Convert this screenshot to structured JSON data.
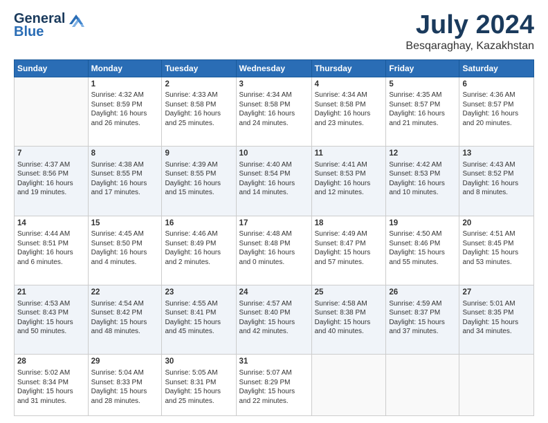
{
  "logo": {
    "line1": "General",
    "line2": "Blue"
  },
  "title": "July 2024",
  "subtitle": "Besqaraghay, Kazakhstan",
  "days_header": [
    "Sunday",
    "Monday",
    "Tuesday",
    "Wednesday",
    "Thursday",
    "Friday",
    "Saturday"
  ],
  "weeks": [
    [
      {
        "day": "",
        "info": ""
      },
      {
        "day": "1",
        "info": "Sunrise: 4:32 AM\nSunset: 8:59 PM\nDaylight: 16 hours\nand 26 minutes."
      },
      {
        "day": "2",
        "info": "Sunrise: 4:33 AM\nSunset: 8:58 PM\nDaylight: 16 hours\nand 25 minutes."
      },
      {
        "day": "3",
        "info": "Sunrise: 4:34 AM\nSunset: 8:58 PM\nDaylight: 16 hours\nand 24 minutes."
      },
      {
        "day": "4",
        "info": "Sunrise: 4:34 AM\nSunset: 8:58 PM\nDaylight: 16 hours\nand 23 minutes."
      },
      {
        "day": "5",
        "info": "Sunrise: 4:35 AM\nSunset: 8:57 PM\nDaylight: 16 hours\nand 21 minutes."
      },
      {
        "day": "6",
        "info": "Sunrise: 4:36 AM\nSunset: 8:57 PM\nDaylight: 16 hours\nand 20 minutes."
      }
    ],
    [
      {
        "day": "7",
        "info": "Sunrise: 4:37 AM\nSunset: 8:56 PM\nDaylight: 16 hours\nand 19 minutes."
      },
      {
        "day": "8",
        "info": "Sunrise: 4:38 AM\nSunset: 8:55 PM\nDaylight: 16 hours\nand 17 minutes."
      },
      {
        "day": "9",
        "info": "Sunrise: 4:39 AM\nSunset: 8:55 PM\nDaylight: 16 hours\nand 15 minutes."
      },
      {
        "day": "10",
        "info": "Sunrise: 4:40 AM\nSunset: 8:54 PM\nDaylight: 16 hours\nand 14 minutes."
      },
      {
        "day": "11",
        "info": "Sunrise: 4:41 AM\nSunset: 8:53 PM\nDaylight: 16 hours\nand 12 minutes."
      },
      {
        "day": "12",
        "info": "Sunrise: 4:42 AM\nSunset: 8:53 PM\nDaylight: 16 hours\nand 10 minutes."
      },
      {
        "day": "13",
        "info": "Sunrise: 4:43 AM\nSunset: 8:52 PM\nDaylight: 16 hours\nand 8 minutes."
      }
    ],
    [
      {
        "day": "14",
        "info": "Sunrise: 4:44 AM\nSunset: 8:51 PM\nDaylight: 16 hours\nand 6 minutes."
      },
      {
        "day": "15",
        "info": "Sunrise: 4:45 AM\nSunset: 8:50 PM\nDaylight: 16 hours\nand 4 minutes."
      },
      {
        "day": "16",
        "info": "Sunrise: 4:46 AM\nSunset: 8:49 PM\nDaylight: 16 hours\nand 2 minutes."
      },
      {
        "day": "17",
        "info": "Sunrise: 4:48 AM\nSunset: 8:48 PM\nDaylight: 16 hours\nand 0 minutes."
      },
      {
        "day": "18",
        "info": "Sunrise: 4:49 AM\nSunset: 8:47 PM\nDaylight: 15 hours\nand 57 minutes."
      },
      {
        "day": "19",
        "info": "Sunrise: 4:50 AM\nSunset: 8:46 PM\nDaylight: 15 hours\nand 55 minutes."
      },
      {
        "day": "20",
        "info": "Sunrise: 4:51 AM\nSunset: 8:45 PM\nDaylight: 15 hours\nand 53 minutes."
      }
    ],
    [
      {
        "day": "21",
        "info": "Sunrise: 4:53 AM\nSunset: 8:43 PM\nDaylight: 15 hours\nand 50 minutes."
      },
      {
        "day": "22",
        "info": "Sunrise: 4:54 AM\nSunset: 8:42 PM\nDaylight: 15 hours\nand 48 minutes."
      },
      {
        "day": "23",
        "info": "Sunrise: 4:55 AM\nSunset: 8:41 PM\nDaylight: 15 hours\nand 45 minutes."
      },
      {
        "day": "24",
        "info": "Sunrise: 4:57 AM\nSunset: 8:40 PM\nDaylight: 15 hours\nand 42 minutes."
      },
      {
        "day": "25",
        "info": "Sunrise: 4:58 AM\nSunset: 8:38 PM\nDaylight: 15 hours\nand 40 minutes."
      },
      {
        "day": "26",
        "info": "Sunrise: 4:59 AM\nSunset: 8:37 PM\nDaylight: 15 hours\nand 37 minutes."
      },
      {
        "day": "27",
        "info": "Sunrise: 5:01 AM\nSunset: 8:35 PM\nDaylight: 15 hours\nand 34 minutes."
      }
    ],
    [
      {
        "day": "28",
        "info": "Sunrise: 5:02 AM\nSunset: 8:34 PM\nDaylight: 15 hours\nand 31 minutes."
      },
      {
        "day": "29",
        "info": "Sunrise: 5:04 AM\nSunset: 8:33 PM\nDaylight: 15 hours\nand 28 minutes."
      },
      {
        "day": "30",
        "info": "Sunrise: 5:05 AM\nSunset: 8:31 PM\nDaylight: 15 hours\nand 25 minutes."
      },
      {
        "day": "31",
        "info": "Sunrise: 5:07 AM\nSunset: 8:29 PM\nDaylight: 15 hours\nand 22 minutes."
      },
      {
        "day": "",
        "info": ""
      },
      {
        "day": "",
        "info": ""
      },
      {
        "day": "",
        "info": ""
      }
    ]
  ]
}
